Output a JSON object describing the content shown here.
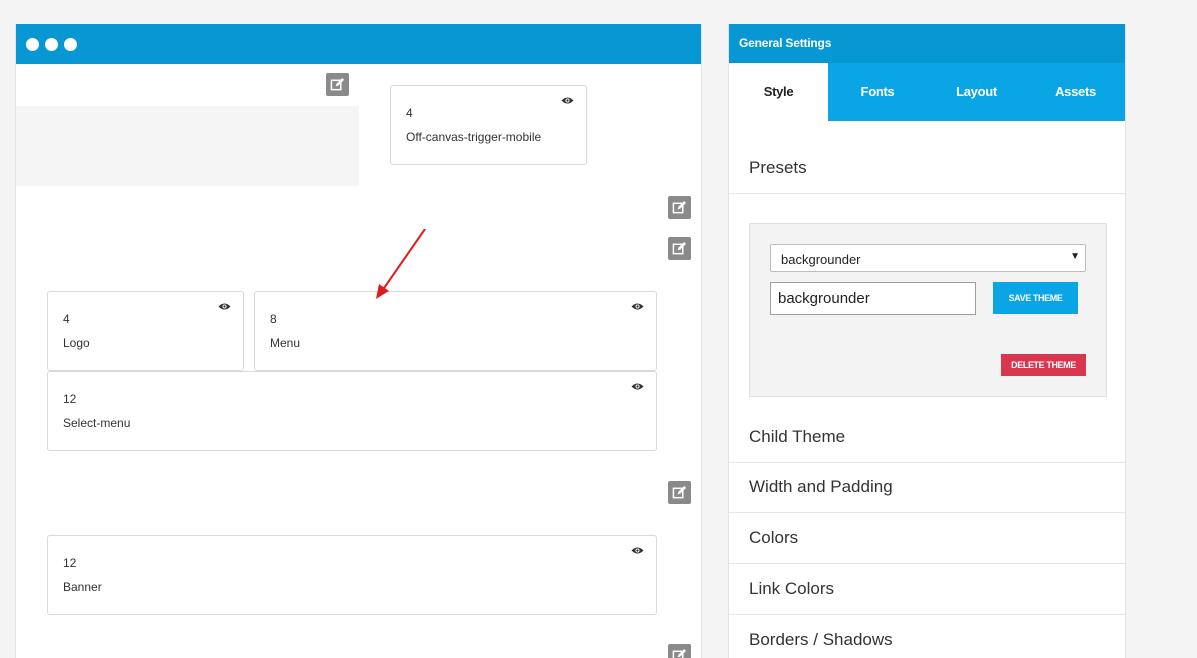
{
  "layout": {
    "modules": [
      {
        "num": "4",
        "label": "Off-canvas-trigger-mobile"
      },
      {
        "num": "4",
        "label": "Logo"
      },
      {
        "num": "8",
        "label": "Menu"
      },
      {
        "num": "12",
        "label": "Select-menu"
      },
      {
        "num": "12",
        "label": "Banner"
      }
    ]
  },
  "settings": {
    "title": "General Settings",
    "tabs": [
      "Style",
      "Fonts",
      "Layout",
      "Assets"
    ],
    "active_tab": "Style",
    "presets": {
      "heading": "Presets",
      "select_value": "backgrounder",
      "input_value": "backgrounder",
      "save_label": "SAVE THEME",
      "delete_label": "DELETE THEME"
    },
    "sections": [
      "Child Theme",
      "Width and Padding",
      "Colors",
      "Link Colors",
      "Borders / Shadows"
    ]
  },
  "colors": {
    "accent": "#0798d3",
    "tab_bar": "#0aa5e5",
    "delete": "#d9374f",
    "annotation_arrow": "#e01b1b"
  },
  "icons": [
    "edit-icon",
    "eye-icon",
    "caret-down-icon",
    "window-dot-icon"
  ]
}
